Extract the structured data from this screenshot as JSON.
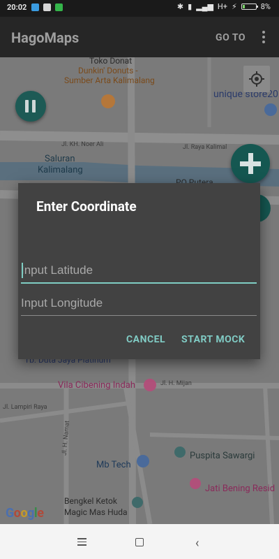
{
  "status_bar": {
    "time": "20:02",
    "network": "H+",
    "battery_percent": "8%"
  },
  "app_bar": {
    "title": "HagoMaps",
    "goto_label": "GO TO"
  },
  "map": {
    "labels": {
      "toko_donat": "Toko Donat",
      "dunkin": "Dunkin' Donuts -",
      "sumber": "Sumber Arta Kalimalang",
      "unique": "unique store20",
      "noer_ali": "Jl. KH. Noer Ali",
      "raya_kalimalang": "Jl. Raya Kalimal",
      "saluran": "Saluran",
      "kalimalang": "Kalimalang",
      "po_putera": "PO Putera",
      "duta_jaya": "Tb. Duta Jaya Platinum",
      "vila": "Vila Cibening Indah",
      "mijan": "Jl. H. Mijan",
      "lampiri": "Jl. Lampiri Raya",
      "namat": "Jl. H. Namat",
      "mb_tech": "Mb Tech",
      "puspita": "Puspita Sawargi",
      "jati": "Jati Bening Resid",
      "bengkel1": "Bengkel Ketok",
      "bengkel2": "Magic Mas Huda",
      "google": "Google"
    }
  },
  "dialog": {
    "title": "Enter Coordinate",
    "latitude_placeholder": "Input Latitude",
    "longitude_placeholder": "Input Longitude",
    "cancel_label": "CANCEL",
    "start_label": "START MOCK"
  },
  "colors": {
    "accent": "#80cbc4",
    "fab": "#155751",
    "dialog_bg": "#424242",
    "appbar_bg": "#262626"
  }
}
